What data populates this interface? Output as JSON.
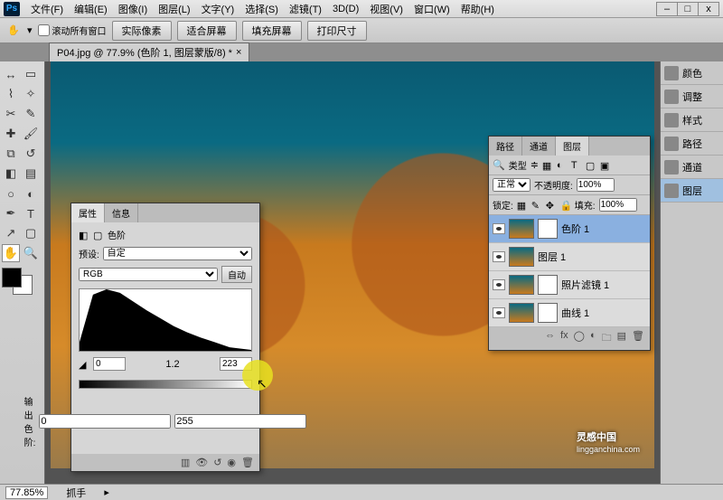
{
  "app": {
    "logo": "Ps"
  },
  "menu": {
    "items": [
      "文件(F)",
      "编辑(E)",
      "图像(I)",
      "图层(L)",
      "文字(Y)",
      "选择(S)",
      "滤镜(T)",
      "3D(D)",
      "视图(V)",
      "窗口(W)",
      "帮助(H)"
    ]
  },
  "winctrl": {
    "min": "–",
    "max": "□",
    "close": "x"
  },
  "options": {
    "scroll_all_label": "滚动所有窗口",
    "buttons": [
      "实际像素",
      "适合屏幕",
      "填充屏幕",
      "打印尺寸"
    ]
  },
  "doc_tab": {
    "title": "P04.jpg @ 77.9% (色阶 1, 图层蒙版/8) *",
    "close": "×"
  },
  "watermark": {
    "line1": "灵感中国",
    "line2": "lingganchina.com"
  },
  "rightdock": {
    "items": [
      {
        "label": "颜色"
      },
      {
        "label": "调整"
      },
      {
        "label": "样式"
      },
      {
        "label": "路径"
      },
      {
        "label": "通道"
      },
      {
        "label": "图层"
      }
    ],
    "selected": 5
  },
  "layerspanel": {
    "tabs": [
      "路径",
      "通道",
      "图层"
    ],
    "active_tab": 2,
    "kind_label": "类型",
    "blend_mode": "正常",
    "opacity_label": "不透明度:",
    "opacity_value": "100%",
    "lock_label": "锁定:",
    "fill_label": "填充:",
    "fill_value": "100%",
    "layers": [
      {
        "name": "色阶 1"
      },
      {
        "name": "图层 1"
      },
      {
        "name": "照片滤镜 1"
      },
      {
        "name": "曲线 1"
      }
    ],
    "selected_layer": 0
  },
  "properties": {
    "tabs": [
      "属性",
      "信息"
    ],
    "active_tab": 0,
    "adj_label": "色阶",
    "preset_label": "预设:",
    "preset_value": "自定",
    "channel": "RGB",
    "auto_label": "自动",
    "input_black": "0",
    "input_gamma": "1.2",
    "input_white": "223",
    "output_label": "输出色阶:",
    "output_black": "0",
    "output_white": "255"
  },
  "status": {
    "zoom": "77.85%",
    "tool": "抓手"
  },
  "chart_data": {
    "type": "area",
    "title": "色阶",
    "xlim": [
      0,
      255
    ],
    "ylabel": "",
    "input_sliders": {
      "black": 0,
      "gamma": 1.2,
      "white": 223
    },
    "output_sliders": {
      "black": 0,
      "white": 255
    },
    "histogram_approx_x": [
      0,
      20,
      40,
      60,
      80,
      100,
      120,
      140,
      160,
      180,
      200,
      223,
      255
    ],
    "histogram_approx_y": [
      15,
      92,
      100,
      95,
      80,
      65,
      52,
      40,
      30,
      22,
      14,
      6,
      2
    ]
  }
}
